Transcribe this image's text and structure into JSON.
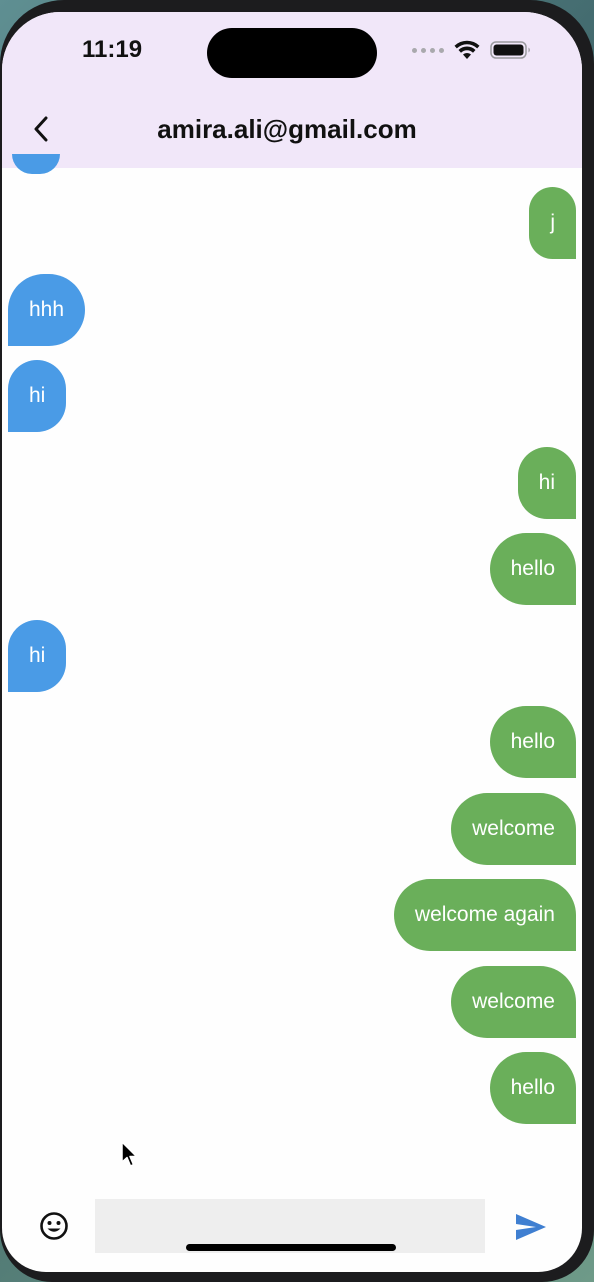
{
  "status_bar": {
    "time": "11:19"
  },
  "header": {
    "title": "amira.ali@gmail.com"
  },
  "messages": [
    {
      "text": "j",
      "direction": "outgoing"
    },
    {
      "text": "hhh",
      "direction": "incoming"
    },
    {
      "text": "hi",
      "direction": "incoming"
    },
    {
      "text": "hi",
      "direction": "outgoing"
    },
    {
      "text": "hello",
      "direction": "outgoing"
    },
    {
      "text": "hi",
      "direction": "incoming"
    },
    {
      "text": "hello",
      "direction": "outgoing"
    },
    {
      "text": "welcome",
      "direction": "outgoing"
    },
    {
      "text": "welcome again",
      "direction": "outgoing"
    },
    {
      "text": "welcome",
      "direction": "outgoing"
    },
    {
      "text": "hello",
      "direction": "outgoing"
    }
  ],
  "input": {
    "value": "",
    "placeholder": ""
  },
  "icons": {
    "back": "chevron-left-icon",
    "emoji": "smiley-icon",
    "send": "send-arrow-icon",
    "wifi": "wifi-icon",
    "battery": "battery-icon",
    "signal": "cellular-dots-icon"
  },
  "colors": {
    "header_bg": "#f1e7f9",
    "incoming_bubble": "#4a9be6",
    "outgoing_bubble": "#6aaf5a",
    "send_icon": "#3f7fd1",
    "input_bg": "#eeeeee"
  }
}
